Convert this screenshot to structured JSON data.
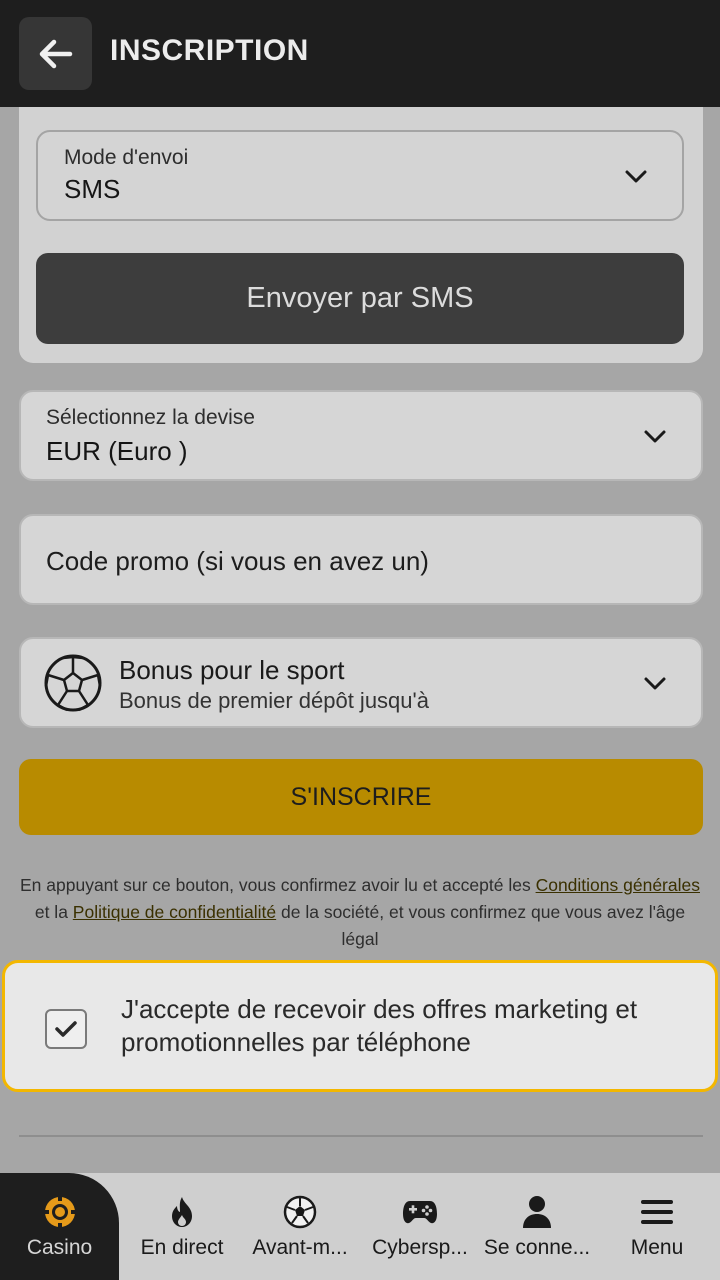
{
  "header": {
    "title": "INSCRIPTION"
  },
  "mode": {
    "label": "Mode d'envoi",
    "value": "SMS"
  },
  "send_button": {
    "label": "Envoyer par SMS"
  },
  "currency": {
    "label": "Sélectionnez la devise",
    "value": "EUR (Euro )"
  },
  "promo": {
    "placeholder": "Code promo (si vous en avez un)"
  },
  "bonus": {
    "title": "Bonus pour le sport",
    "subtitle": "Bonus de premier dépôt jusqu'à"
  },
  "register_button": {
    "label": "S'INSCRIRE"
  },
  "legal": {
    "part1": "En appuyant sur ce bouton, vous confirmez avoir lu et accepté les ",
    "link1": "Conditions générales",
    "part2": " et la ",
    "link2": "Politique de confidentialité",
    "part3": " de la société, et vous confirmez que vous avez l'âge légal"
  },
  "consent": {
    "text": "J'accepte de recevoir des offres marketing et promotionnelles par téléphone",
    "checked": true
  },
  "colors": {
    "accent": "#b88b00",
    "highlight": "#f3b700",
    "header": "#1e1e1e"
  },
  "nav": {
    "items": [
      {
        "label": "Casino",
        "icon": "casino-chip-icon"
      },
      {
        "label": "En direct",
        "icon": "flame-icon"
      },
      {
        "label": "Avant-m...",
        "icon": "soccer-ball-icon"
      },
      {
        "label": "Cybersp...",
        "icon": "gamepad-icon"
      },
      {
        "label": "Se conne...",
        "icon": "user-icon"
      },
      {
        "label": "Menu",
        "icon": "hamburger-icon"
      }
    ]
  }
}
